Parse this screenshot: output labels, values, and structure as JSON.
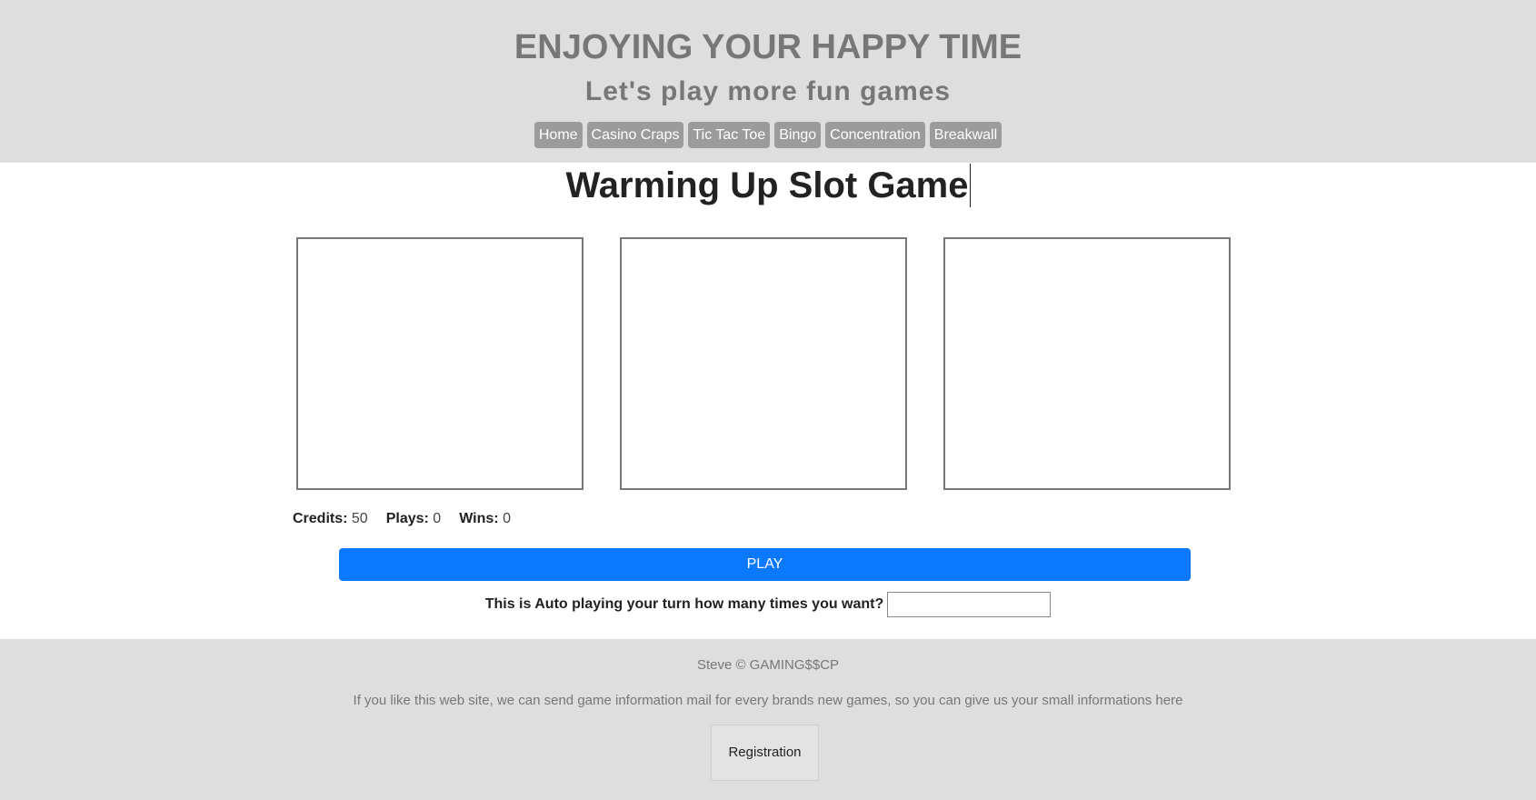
{
  "header": {
    "title": "ENJOYING YOUR HAPPY TIME",
    "subtitle": "Let's play more fun games",
    "nav": [
      "Home",
      "Casino Craps",
      "Tic Tac Toe",
      "Bingo",
      "Concentration",
      "Breakwall"
    ]
  },
  "game": {
    "title": "Warming Up Slot Game",
    "stats": {
      "credits_label": "Credits:",
      "credits": "50",
      "plays_label": "Plays:",
      "plays": "0",
      "wins_label": "Wins:",
      "wins": "0"
    },
    "play_label": "PLAY",
    "auto_label": "This is Auto playing your turn how many times you want?",
    "auto_value": ""
  },
  "footer": {
    "copyright": "Steve © GAMING$$CP",
    "message": "If you like this web site, we can send game information mail for every brands new games, so you can give us your small informations here",
    "register_label": "Registration"
  },
  "colors": {
    "header_bg": "#dedede",
    "nav_button": "#9b9b9b",
    "play_button": "#0a78ff"
  }
}
